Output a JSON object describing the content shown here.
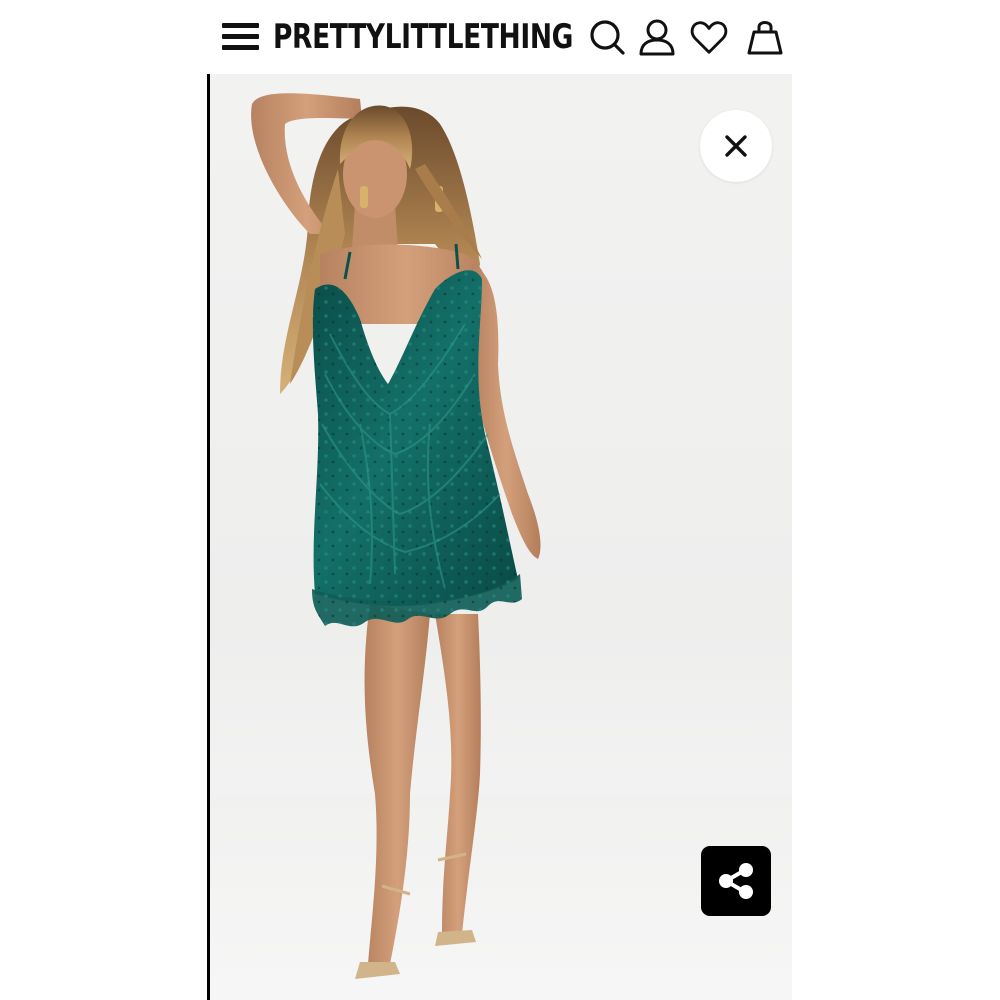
{
  "header": {
    "brand": "PRETTYLITTLETHING",
    "icons": [
      "menu-icon",
      "search-icon",
      "account-icon",
      "wishlist-heart-icon",
      "shopping-bag-icon"
    ]
  },
  "viewer": {
    "image_subject": "model-in-emerald-sequin-dress",
    "close_icon": "close-icon",
    "share_icon": "share-icon"
  },
  "colors": {
    "text": "#111111",
    "background": "#ffffff",
    "image_background": "#f0f0ef",
    "dress": "#0e5a55",
    "share_button": "#000000"
  }
}
